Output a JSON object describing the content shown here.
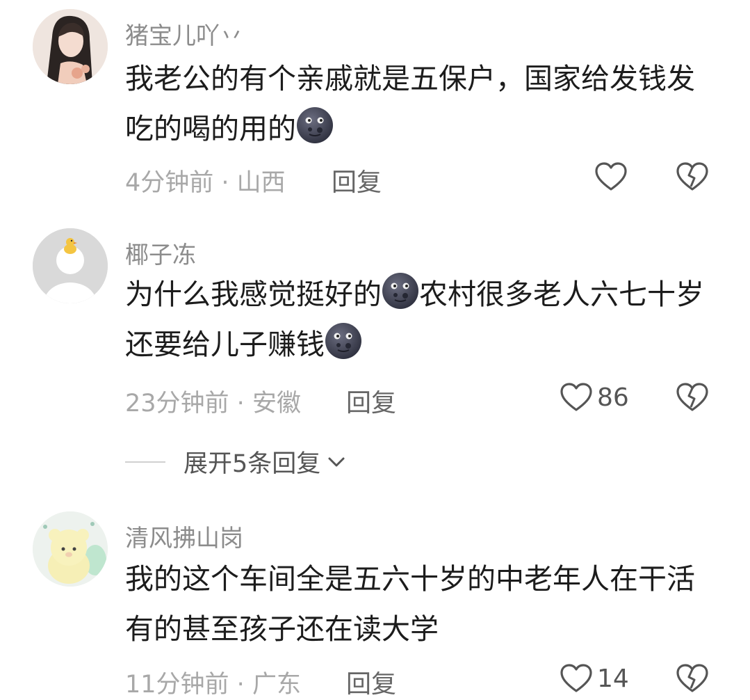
{
  "comments": [
    {
      "username": "猪宝儿吖丷",
      "text_parts": [
        "我老公的有个亲戚就是五保户，国家给发钱发吃的喝的用的"
      ],
      "emoji_icon": "new-moon-face-emoji",
      "time": "4分钟前",
      "location": "山西",
      "reply_label": "回复",
      "likes": ""
    },
    {
      "username": "椰子冻",
      "text_parts": [
        "为什么我感觉挺好的",
        "农村很多老人六七十岁还要给儿子赚钱"
      ],
      "emoji_icon": "new-moon-face-emoji",
      "time": "23分钟前",
      "location": "安徽",
      "reply_label": "回复",
      "likes": "86",
      "expand_label": "展开5条回复"
    },
    {
      "username": "清风拂山岗",
      "text": "我的这个车间全是五六十岁的中老年人在干活 有的甚至孩子还在读大学",
      "time": "11分钟前",
      "location": "广东",
      "reply_label": "回复",
      "likes": "14"
    }
  ],
  "separator": " · ",
  "colors": {
    "username": "#8c8c8c",
    "text": "#1c1c1c",
    "meta": "#a8a8a8",
    "icon": "#555555"
  },
  "icons": {
    "like": "heart-outline-icon",
    "dislike": "broken-heart-icon",
    "expand": "chevron-down-icon"
  }
}
